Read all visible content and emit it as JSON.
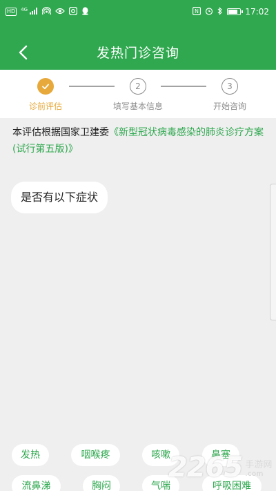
{
  "status_bar": {
    "left_labels": [
      "HD",
      "4G"
    ],
    "time": "17:02",
    "battery_level": 0.85,
    "icons_left": [
      "hd-icon",
      "signal-icon",
      "hotspot-icon",
      "eye-care-icon",
      "qq-browser-icon",
      "qq-icon"
    ],
    "icons_right": [
      "nfc-icon",
      "alarm-icon",
      "bluetooth-icon",
      "battery-icon"
    ]
  },
  "header": {
    "title": "发热门诊咨询",
    "back_icon": "chevron-left-icon",
    "background": "#2fa84f"
  },
  "steps": {
    "active_color": "#e7a93b",
    "items": [
      {
        "number": "1",
        "label": "诊前评估",
        "state": "done"
      },
      {
        "number": "2",
        "label": "填写基本信息",
        "state": "todo"
      },
      {
        "number": "3",
        "label": "开始咨询",
        "state": "todo"
      }
    ]
  },
  "intro": {
    "prefix": "本评估根据国家卫建委",
    "link": "《新型冠状病毒感染的肺炎诊疗方案(试行第五版)》"
  },
  "question": "是否有以下症状",
  "symptoms": [
    "发热",
    "咽喉疼",
    "咳嗽",
    "鼻塞",
    "流鼻涕",
    "胸闷",
    "气喘",
    "呼吸困难"
  ],
  "watermark": {
    "number": "2265",
    "suffix": ".com",
    "text": "手游网"
  }
}
